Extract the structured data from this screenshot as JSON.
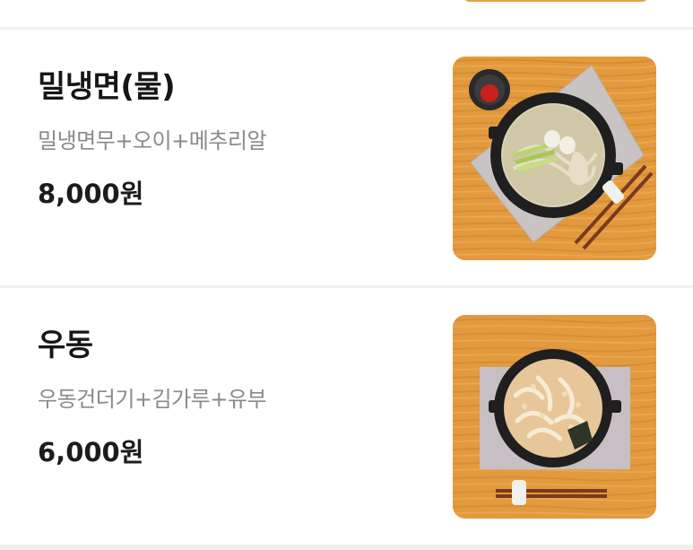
{
  "menu": {
    "items": [
      {
        "name": "밀냉면(물)",
        "description": "밀냉면무+오이+메추리알",
        "price": "8,000원",
        "image_icon": "cold-noodle-bowl-photo"
      },
      {
        "name": "우동",
        "description": "우동건더기+김가루+유부",
        "price": "6,000원",
        "image_icon": "udon-bowl-photo"
      }
    ]
  },
  "colors": {
    "name": "#161616",
    "description": "#8a8a8a",
    "price": "#1c1c1c",
    "divider": "#f0f0f0",
    "wood": "#e39a3e"
  }
}
